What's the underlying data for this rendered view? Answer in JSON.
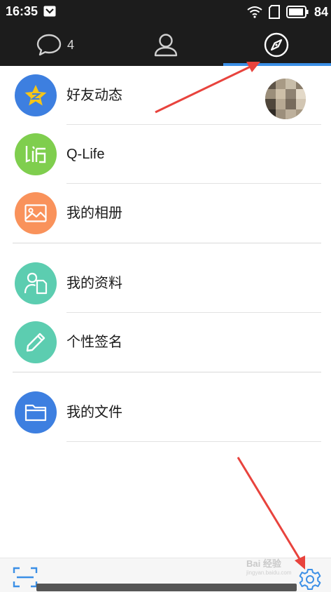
{
  "status_bar": {
    "time": "16:35",
    "battery": "84"
  },
  "tabs": [
    {
      "name": "messages",
      "icon": "chat-bubble-icon",
      "count": "4"
    },
    {
      "name": "contacts",
      "icon": "person-icon"
    },
    {
      "name": "discover",
      "icon": "compass-icon",
      "selected": true
    }
  ],
  "colors": {
    "tab_bg": "#1c1c1c",
    "accent": "#3b8fe6",
    "qzone": "#3d7fe0",
    "qlife": "#7fce4e",
    "album": "#f9925b",
    "profile": "#5ccdb0",
    "signature": "#5ccdb0",
    "files": "#3d7fe0",
    "annotation_arrow": "#e8433d"
  },
  "menu": {
    "group1": [
      {
        "label": "好友动态",
        "icon": "qzone-star-icon"
      },
      {
        "label": "Q-Life",
        "icon": "qlife-icon"
      },
      {
        "label": "我的相册",
        "icon": "photo-album-icon"
      }
    ],
    "group2": [
      {
        "label": "我的资料",
        "icon": "profile-card-icon"
      },
      {
        "label": "个性签名",
        "icon": "pencil-icon"
      }
    ],
    "group3": [
      {
        "label": "我的文件",
        "icon": "folder-icon"
      }
    ]
  },
  "bottom_bar": {
    "left_icon": "scan-icon",
    "right_icon": "settings-gear-icon"
  },
  "watermark": {
    "text": "Bai 经验",
    "sub": "jingyan.baidu.com"
  }
}
